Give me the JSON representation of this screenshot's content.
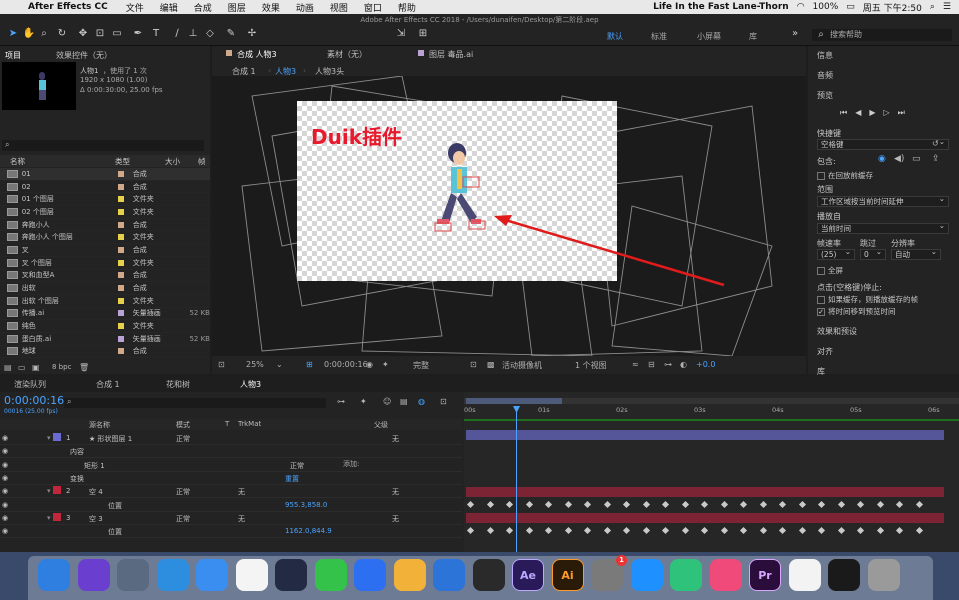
{
  "menubar": {
    "app": "After Effects CC",
    "items": [
      "文件",
      "编辑",
      "合成",
      "图层",
      "效果",
      "动画",
      "视图",
      "窗口",
      "帮助"
    ],
    "now_playing": "Life In the Fast Lane-Thorn",
    "battery": "100%",
    "clock": "周五 下午2:50"
  },
  "window_title": "Adobe After Effects CC 2018 - /Users/dunaifen/Desktop/第二阶段.aep",
  "workspaces": [
    "默认",
    "标准",
    "小屏幕",
    "库"
  ],
  "search_help": "搜索帮助",
  "project": {
    "tab": "项目",
    "effects_tab": "效果控件（无）",
    "selected_name": "人物1",
    "used": "，使用了 1 次",
    "info1": "1920 x 1080 (1.00)",
    "info2": "Δ 0:00:30:00, 25.00 fps",
    "columns": [
      "名称",
      "类型",
      "大小",
      "帧"
    ],
    "items": [
      {
        "name": "01",
        "type": "合成",
        "size": "",
        "color": "#cfa98a"
      },
      {
        "name": "02",
        "type": "合成",
        "size": "",
        "color": "#cfa98a"
      },
      {
        "name": "01 个图层",
        "type": "文件夹",
        "size": "",
        "color": "#e6d24a"
      },
      {
        "name": "02 个图层",
        "type": "文件夹",
        "size": "",
        "color": "#e6d24a"
      },
      {
        "name": "奔跑小人",
        "type": "合成",
        "size": "",
        "color": "#cfa98a"
      },
      {
        "name": "奔跑小人 个图层",
        "type": "文件夹",
        "size": "",
        "color": "#e6d24a"
      },
      {
        "name": "叉",
        "type": "合成",
        "size": "",
        "color": "#cfa98a"
      },
      {
        "name": "叉 个图层",
        "type": "文件夹",
        "size": "",
        "color": "#e6d24a"
      },
      {
        "name": "叉和血型A",
        "type": "合成",
        "size": "",
        "color": "#cfa98a"
      },
      {
        "name": "出软",
        "type": "合成",
        "size": "",
        "color": "#cfa98a"
      },
      {
        "name": "出软 个图层",
        "type": "文件夹",
        "size": "",
        "color": "#e6d24a"
      },
      {
        "name": "传播.ai",
        "type": "矢量插画",
        "size": "52 KB",
        "color": "#b9a2d6"
      },
      {
        "name": "纯色",
        "type": "文件夹",
        "size": "",
        "color": "#e6d24a"
      },
      {
        "name": "蛋白质.ai",
        "type": "矢量插画",
        "size": "52 KB",
        "color": "#b9a2d6"
      },
      {
        "name": "地球",
        "type": "合成",
        "size": "",
        "color": "#cfa98a"
      }
    ],
    "bpc": "8 bpc"
  },
  "viewer": {
    "comp_tab": "合成 人物3",
    "footage_tab": "素材（无）",
    "layer_tab": "图层 毒品.ai",
    "breadcrumbs": [
      "合成 1",
      "人物3",
      "人物3头"
    ],
    "overlay_text": "Duik插件",
    "zoom": "25%",
    "timecode": "0:00:00:16",
    "quality": "完整",
    "camera": "活动摄像机",
    "views": "1 个视图",
    "exposure": "+0.0"
  },
  "right_panel": {
    "info": "信息",
    "audio": "音频",
    "preview": "预览",
    "shortcut_label": "快捷键",
    "shortcut_value": "空格键",
    "include": "包含:",
    "cache_before": "在回放前缓存",
    "range_label": "范围",
    "range_value": "工作区域按当前时间延伸",
    "play_from_label": "播放自",
    "play_from_value": "当前时间",
    "fps_label": "帧速率",
    "skip_label": "跳过",
    "res_label": "分辨率",
    "fps_value": "(25)",
    "skip_value": "0",
    "res_value": "自动",
    "fullscreen": "全屏",
    "stop_label": "点击(空格键)停止:",
    "stop_opt1": "如果缓存，则播放缓存的帧",
    "stop_opt2": "将时间移到预览时间",
    "effects_presets": "效果和预设",
    "align": "对齐",
    "library": "库"
  },
  "timeline": {
    "tabs": [
      "渲染队列",
      "合成 1",
      "花和树",
      "人物3"
    ],
    "timecode": "0:00:00:16",
    "subtime": "00016 (25.00 fps)",
    "headers": [
      "源名称",
      "模式",
      "T",
      "TrkMat",
      "父级"
    ],
    "ruler": [
      "00s",
      "01s",
      "02s",
      "03s",
      "04s",
      "05s",
      "06s"
    ],
    "layers": [
      {
        "num": "1",
        "name": "形状图层 1",
        "mode": "正常",
        "trkmat": "",
        "parent": "无",
        "color": "#6a6ad0"
      },
      {
        "num": "",
        "name": "内容",
        "mode": "",
        "trkmat": "",
        "parent": "",
        "color": ""
      },
      {
        "num": "",
        "name": "矩形 1",
        "mode": "正常",
        "trkmat": "",
        "parent": "",
        "color": ""
      },
      {
        "num": "",
        "name": "变换",
        "mode": "重置",
        "trkmat": "",
        "parent": "",
        "color": ""
      },
      {
        "num": "2",
        "name": "空 4",
        "mode": "正常",
        "trkmat": "无",
        "parent": "无",
        "color": "#c0273a"
      },
      {
        "num": "",
        "name": "位置",
        "mode": "955.3,858.0",
        "trkmat": "",
        "parent": "",
        "color": ""
      },
      {
        "num": "3",
        "name": "空 3",
        "mode": "正常",
        "trkmat": "无",
        "parent": "无",
        "color": "#c0273a"
      },
      {
        "num": "",
        "name": "位置",
        "mode": "1162.0,844.9",
        "trkmat": "",
        "parent": "",
        "color": ""
      }
    ],
    "add_label": "添加:"
  },
  "dock": {
    "apps": [
      "finder",
      "siri",
      "launchpad",
      "safari",
      "ime",
      "photos",
      "cinema4d",
      "wechat",
      "baidu",
      "sketch",
      "keynote",
      "finalcut",
      "Ae",
      "Ai",
      "preferences",
      "appstore",
      "qqmusic",
      "itunes",
      "Pr",
      "textedit",
      "screen",
      "trash"
    ],
    "badge": "1"
  }
}
